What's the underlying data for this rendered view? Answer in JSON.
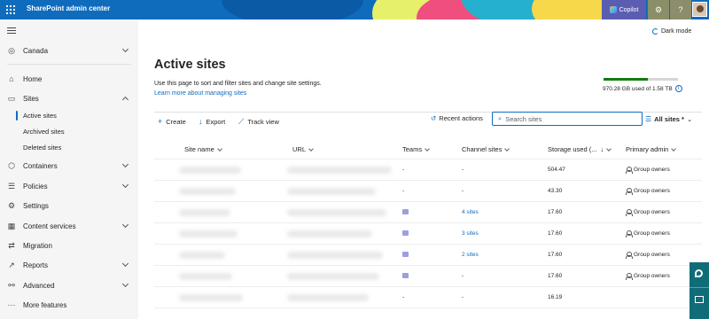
{
  "app": {
    "title": "SharePoint admin center",
    "copilot_label": "Copilot"
  },
  "sidebar": {
    "tenant": "Canada",
    "items": [
      {
        "label": "Home",
        "icon": "home-icon"
      },
      {
        "label": "Sites",
        "icon": "sites-icon"
      },
      {
        "label": "Containers",
        "icon": "containers-icon"
      },
      {
        "label": "Policies",
        "icon": "policies-icon"
      },
      {
        "label": "Settings",
        "icon": "gear-icon"
      },
      {
        "label": "Content services",
        "icon": "content-services-icon"
      },
      {
        "label": "Migration",
        "icon": "migration-icon"
      },
      {
        "label": "Reports",
        "icon": "reports-icon"
      },
      {
        "label": "Advanced",
        "icon": "advanced-icon"
      },
      {
        "label": "More features",
        "icon": "more-features-icon"
      }
    ],
    "sites_sub": [
      "Active sites",
      "Archived sites",
      "Deleted sites"
    ],
    "active_sub": "Active sites"
  },
  "header": {
    "dark_mode": "Dark mode"
  },
  "page": {
    "title": "Active sites",
    "description": "Use this page to sort and filter sites and change site settings.",
    "learn_link": "Learn more about managing sites"
  },
  "storage": {
    "text": "970.28 GB used of 1.58 TB",
    "used_fraction": 0.6
  },
  "commands": {
    "create": "Create",
    "export": "Export",
    "track": "Track view",
    "recent": "Recent actions",
    "search_placeholder": "Search sites",
    "filter": "All sites *"
  },
  "table": {
    "columns": [
      "Site name",
      "URL",
      "Teams",
      "Channel sites",
      "Storage used (...",
      "Primary admin"
    ],
    "rows": [
      {
        "teams": "-",
        "channel": "-",
        "storage": "504.47",
        "admin": "Group owners",
        "has_teams": false,
        "channel_link": false
      },
      {
        "teams": "-",
        "channel": "-",
        "storage": "43.30",
        "admin": "Group owners",
        "has_teams": false,
        "channel_link": false
      },
      {
        "teams": "",
        "channel": "4 sites",
        "storage": "17.60",
        "admin": "Group owners",
        "has_teams": true,
        "channel_link": true
      },
      {
        "teams": "",
        "channel": "3 sites",
        "storage": "17.60",
        "admin": "Group owners",
        "has_teams": true,
        "channel_link": true
      },
      {
        "teams": "",
        "channel": "2 sites",
        "storage": "17.60",
        "admin": "Group owners",
        "has_teams": true,
        "channel_link": true
      },
      {
        "teams": "",
        "channel": "-",
        "storage": "17.60",
        "admin": "Group owners",
        "has_teams": true,
        "channel_link": false
      },
      {
        "teams": "-",
        "channel": "-",
        "storage": "16.19",
        "admin": "",
        "has_teams": false,
        "channel_link": false
      }
    ]
  },
  "colors": {
    "brand": "#0f6cbd",
    "sidebar_bg": "#f5f5f5",
    "storage_fill": "#107c10"
  }
}
